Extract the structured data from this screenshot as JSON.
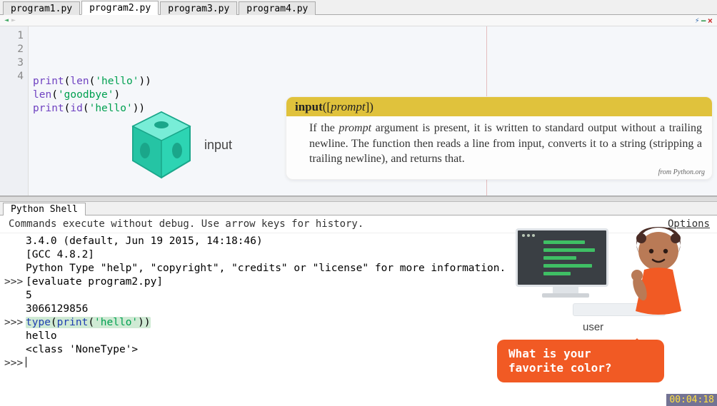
{
  "tabs": [
    {
      "label": "program1.py",
      "active": false
    },
    {
      "label": "program2.py",
      "active": true
    },
    {
      "label": "program3.py",
      "active": false
    },
    {
      "label": "program4.py",
      "active": false
    }
  ],
  "editor": {
    "line_numbers": [
      "1",
      "2",
      "3",
      "4"
    ],
    "lines": [
      {
        "tokens": [
          {
            "t": "fn",
            "v": "print"
          },
          {
            "t": "",
            "v": "("
          },
          {
            "t": "fn",
            "v": "len"
          },
          {
            "t": "",
            "v": "("
          },
          {
            "t": "str",
            "v": "'hello'"
          },
          {
            "t": "",
            "v": "))"
          }
        ]
      },
      {
        "tokens": [
          {
            "t": "fn",
            "v": "len"
          },
          {
            "t": "",
            "v": "("
          },
          {
            "t": "str",
            "v": "'goodbye'"
          },
          {
            "t": "",
            "v": ")"
          }
        ]
      },
      {
        "tokens": [
          {
            "t": "fn",
            "v": "print"
          },
          {
            "t": "",
            "v": "("
          },
          {
            "t": "fn",
            "v": "id"
          },
          {
            "t": "",
            "v": "("
          },
          {
            "t": "str",
            "v": "'hello'"
          },
          {
            "t": "",
            "v": "))"
          }
        ]
      },
      {
        "tokens": []
      }
    ]
  },
  "cube_label": "input",
  "doc_card": {
    "fn": "input",
    "sig_open": "([",
    "param": "prompt",
    "sig_close": "])",
    "body_parts": {
      "pre": "If the ",
      "em": "prompt",
      "post": " argument is present, it is written to standard output without a trailing newline. The function then reads a line from input, converts it to a string (stripping a trailing newline), and returns that."
    },
    "source": "from Python.org"
  },
  "shell": {
    "tab": "Python Shell",
    "msg": "Commands execute without debug.  Use arrow keys for history.",
    "options": "Options",
    "lines": [
      {
        "prompt": "",
        "text": "3.4.0 (default, Jun 19 2015, 14:18:46)"
      },
      {
        "prompt": "",
        "text": "[GCC 4.8.2]"
      },
      {
        "prompt": "",
        "text": "Python Type \"help\", \"copyright\", \"credits\" or \"license\" for more information."
      },
      {
        "prompt": ">>>",
        "text": "[evaluate program2.py]"
      },
      {
        "prompt": "",
        "text": "5"
      },
      {
        "prompt": "",
        "text": "3066129856"
      },
      {
        "prompt": ">>>",
        "rich": [
          {
            "t": "shell-fn",
            "v": "type"
          },
          {
            "t": "",
            "v": "("
          },
          {
            "t": "shell-fn",
            "v": "print"
          },
          {
            "t": "",
            "v": "("
          },
          {
            "t": "shell-str",
            "v": "'hello'"
          },
          {
            "t": "",
            "v": ")"
          },
          {
            "t": "hl-close",
            "v": ")"
          }
        ]
      },
      {
        "prompt": "",
        "text": "hello"
      },
      {
        "prompt": "",
        "text": "<class 'NoneType'>"
      },
      {
        "prompt": ">>>",
        "cursor": true
      }
    ]
  },
  "user_label": "user",
  "speech": "What is your favorite color?",
  "timestamp": "00:04:18"
}
